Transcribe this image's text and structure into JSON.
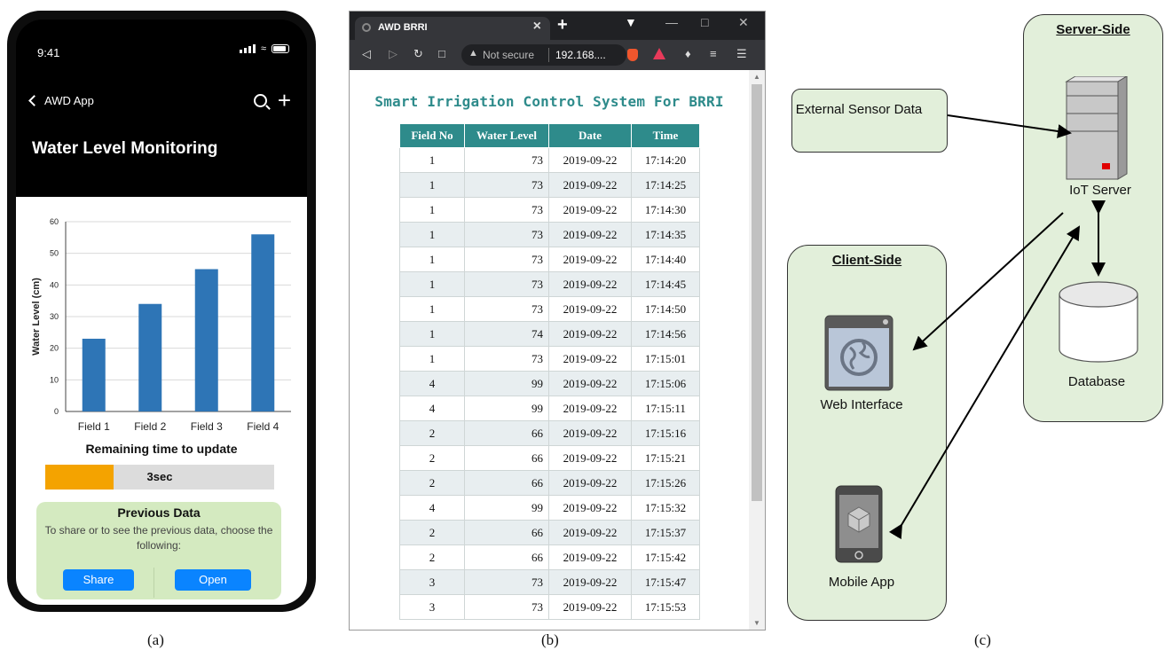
{
  "panel_a": {
    "label": "(a)",
    "status_time": "9:41",
    "back_label": "AWD App",
    "page_title": "Water Level Monitoring",
    "chart_data": {
      "type": "bar",
      "categories": [
        "Field 1",
        "Field 2",
        "Field 3",
        "Field 4"
      ],
      "values": [
        23,
        34,
        45,
        56
      ],
      "ylabel": "Water Level (cm)",
      "ylim": [
        0,
        60
      ],
      "yticks": [
        0,
        10,
        20,
        30,
        40,
        50,
        60
      ],
      "bar_color": "#2e75b6",
      "grid": true
    },
    "remaining_label": "Remaining time to update",
    "progress_value": 0.3,
    "progress_text": "3sec",
    "previous_title": "Previous Data",
    "previous_text": "To share or to see the previous data, choose the following:",
    "share_label": "Share",
    "open_label": "Open",
    "colors": {
      "accent": "#0a84ff",
      "progress": "#f4a300",
      "card": "#d4eac0"
    }
  },
  "panel_b": {
    "label": "(b)",
    "tab_title": "AWD BRRI",
    "tab_close": "×",
    "new_tab": "+",
    "url_not_secure": "Not secure",
    "url_address": "192.168....",
    "heading": "Smart Irrigation Control System For BRRI",
    "columns": [
      "Field No",
      "Water Level",
      "Date",
      "Time"
    ],
    "rows": [
      [
        "1",
        "73",
        "2019-09-22",
        "17:14:20"
      ],
      [
        "1",
        "73",
        "2019-09-22",
        "17:14:25"
      ],
      [
        "1",
        "73",
        "2019-09-22",
        "17:14:30"
      ],
      [
        "1",
        "73",
        "2019-09-22",
        "17:14:35"
      ],
      [
        "1",
        "73",
        "2019-09-22",
        "17:14:40"
      ],
      [
        "1",
        "73",
        "2019-09-22",
        "17:14:45"
      ],
      [
        "1",
        "73",
        "2019-09-22",
        "17:14:50"
      ],
      [
        "1",
        "74",
        "2019-09-22",
        "17:14:56"
      ],
      [
        "1",
        "73",
        "2019-09-22",
        "17:15:01"
      ],
      [
        "4",
        "99",
        "2019-09-22",
        "17:15:06"
      ],
      [
        "4",
        "99",
        "2019-09-22",
        "17:15:11"
      ],
      [
        "2",
        "66",
        "2019-09-22",
        "17:15:16"
      ],
      [
        "2",
        "66",
        "2019-09-22",
        "17:15:21"
      ],
      [
        "2",
        "66",
        "2019-09-22",
        "17:15:26"
      ],
      [
        "4",
        "99",
        "2019-09-22",
        "17:15:32"
      ],
      [
        "2",
        "66",
        "2019-09-22",
        "17:15:37"
      ],
      [
        "2",
        "66",
        "2019-09-22",
        "17:15:42"
      ],
      [
        "3",
        "73",
        "2019-09-22",
        "17:15:47"
      ],
      [
        "3",
        "73",
        "2019-09-22",
        "17:15:53"
      ]
    ],
    "colors": {
      "heading": "#2e8b8b",
      "header_bg": "#2e8b8b",
      "stripe": "#e8eef0"
    }
  },
  "panel_c": {
    "label": "(c)",
    "server_side_title": "Server-Side",
    "client_side_title": "Client-Side",
    "external_sensor_text": "External Sensor Data",
    "iot_server_label": "IoT Server",
    "database_label": "Database",
    "web_interface_label": "Web Interface",
    "mobile_app_label": "Mobile App",
    "colors": {
      "region_fill": "#e2efda",
      "led": "#e00000"
    }
  }
}
